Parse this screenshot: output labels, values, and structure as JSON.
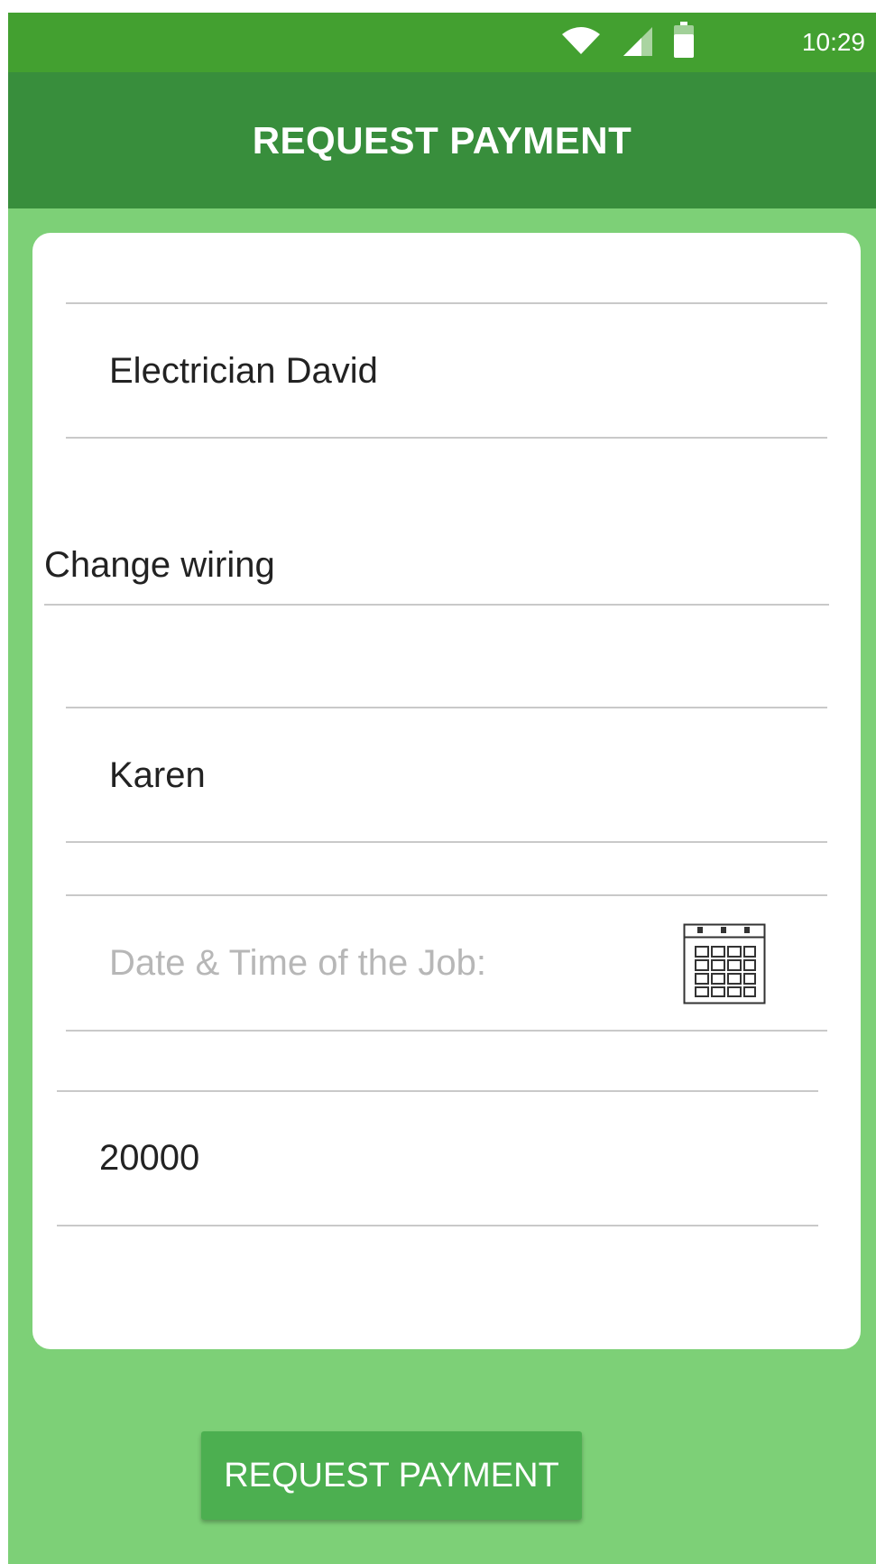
{
  "status_bar": {
    "time": "10:29",
    "icons": [
      "wifi-icon",
      "signal-icon",
      "battery-icon"
    ]
  },
  "app_bar": {
    "title": "REQUEST PAYMENT"
  },
  "form": {
    "provider_name": "Electrician David",
    "job_description": "Change wiring",
    "customer_name": "Karen",
    "date_time_placeholder": "Date & Time of the Job:",
    "amount": "20000"
  },
  "actions": {
    "submit_label": "REQUEST PAYMENT"
  },
  "colors": {
    "status_bar": "#43a030",
    "app_bar": "#388e3c",
    "background": "#7dd077",
    "button": "#4caf50"
  }
}
